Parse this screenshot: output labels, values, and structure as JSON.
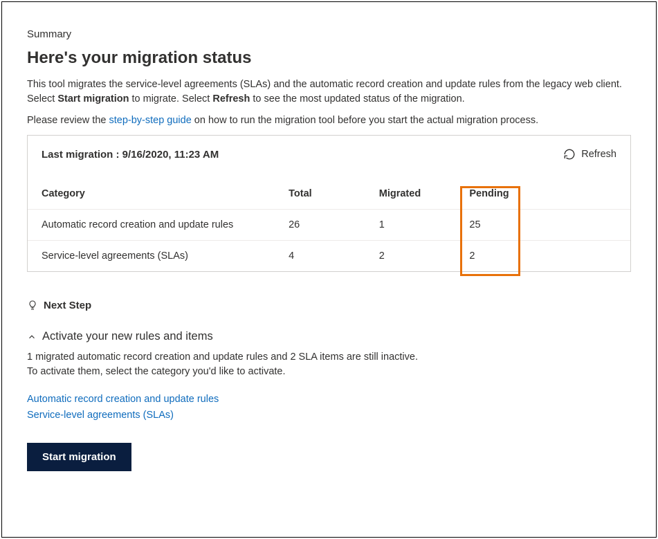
{
  "summary_label": "Summary",
  "title": "Here's your migration status",
  "description_parts": {
    "p1_a": "This tool migrates the service-level agreements (SLAs) and the automatic record creation and update rules from the legacy web client. Select ",
    "p1_b": "Start migration",
    "p1_c": " to migrate. Select ",
    "p1_d": "Refresh",
    "p1_e": " to see the most updated status of the migration."
  },
  "guide_sentence": {
    "a": "Please review the ",
    "link": "step-by-step guide",
    "b": " on how to run the migration tool before you start the actual migration process."
  },
  "last_migration_label": "Last migration : 9/16/2020, 11:23 AM",
  "refresh_label": "Refresh",
  "table": {
    "headers": {
      "category": "Category",
      "total": "Total",
      "migrated": "Migrated",
      "pending": "Pending"
    },
    "rows": [
      {
        "category": "Automatic record creation and update rules",
        "total": "26",
        "migrated": "1",
        "pending": "25"
      },
      {
        "category": "Service-level agreements (SLAs)",
        "total": "4",
        "migrated": "2",
        "pending": "2"
      }
    ]
  },
  "next_step_label": "Next Step",
  "activate_heading": "Activate your new rules and items",
  "activate_desc_line1": "1 migrated automatic record creation and update rules and 2 SLA items are still inactive.",
  "activate_desc_line2": "To activate them, select the category you'd like to activate.",
  "activate_links": {
    "arc": "Automatic record creation and update rules",
    "sla": "Service-level agreements (SLAs)"
  },
  "start_migration_label": "Start migration"
}
